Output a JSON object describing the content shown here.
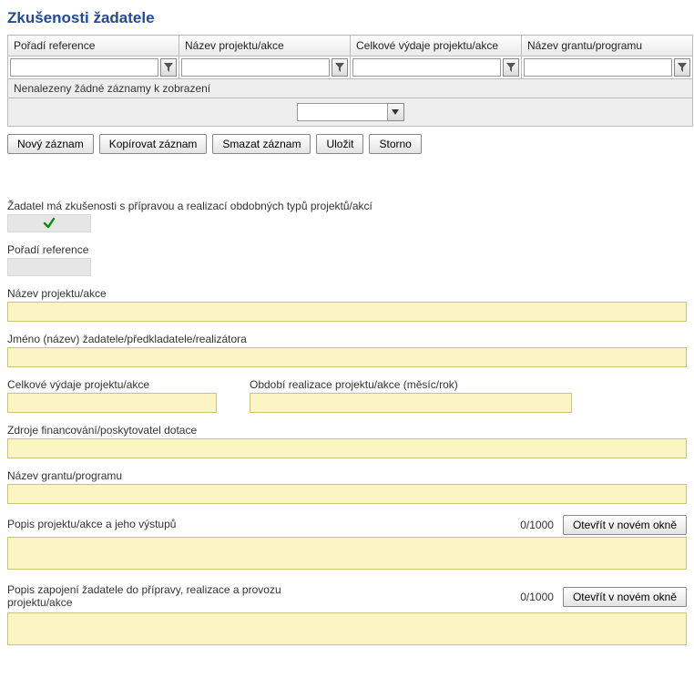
{
  "title": "Zkušenosti žadatele",
  "grid": {
    "headers": {
      "poradi": "Pořadí reference",
      "nazev_projektu": "Název projektu/akce",
      "celkove_vydaje": "Celkové výdaje projektu/akce",
      "nazev_grantu": "Název grantu/programu"
    },
    "no_records": "Nenalezeny žádné záznamy k zobrazení"
  },
  "toolbar": {
    "novy": "Nový záznam",
    "kopirovat": "Kopírovat záznam",
    "smazat": "Smazat záznam",
    "ulozit": "Uložit",
    "storno": "Storno"
  },
  "form": {
    "zadatel_ma_zkusenosti": "Žadatel má zkušenosti s přípravou a realizací obdobných typů projektů/akcí",
    "poradi_reference": "Pořadí reference",
    "nazev_projektu": "Název projektu/akce",
    "jmeno_zadatele": "Jméno (název) žadatele/předkladatele/realizátora",
    "celkove_vydaje": "Celkové výdaje projektu/akce",
    "obdobi_realizace": "Období realizace projektu/akce (měsíc/rok)",
    "zdroje_financovani": "Zdroje financování/poskytovatel dotace",
    "nazev_grantu": "Název grantu/programu",
    "popis_projektu": "Popis projektu/akce a jeho výstupů",
    "popis_zapojeni": "Popis zapojení žadatele do přípravy, realizace a provozu projektu/akce",
    "counter1": "0/1000",
    "counter2": "0/1000",
    "open_window": "Otevřít v novém okně"
  }
}
